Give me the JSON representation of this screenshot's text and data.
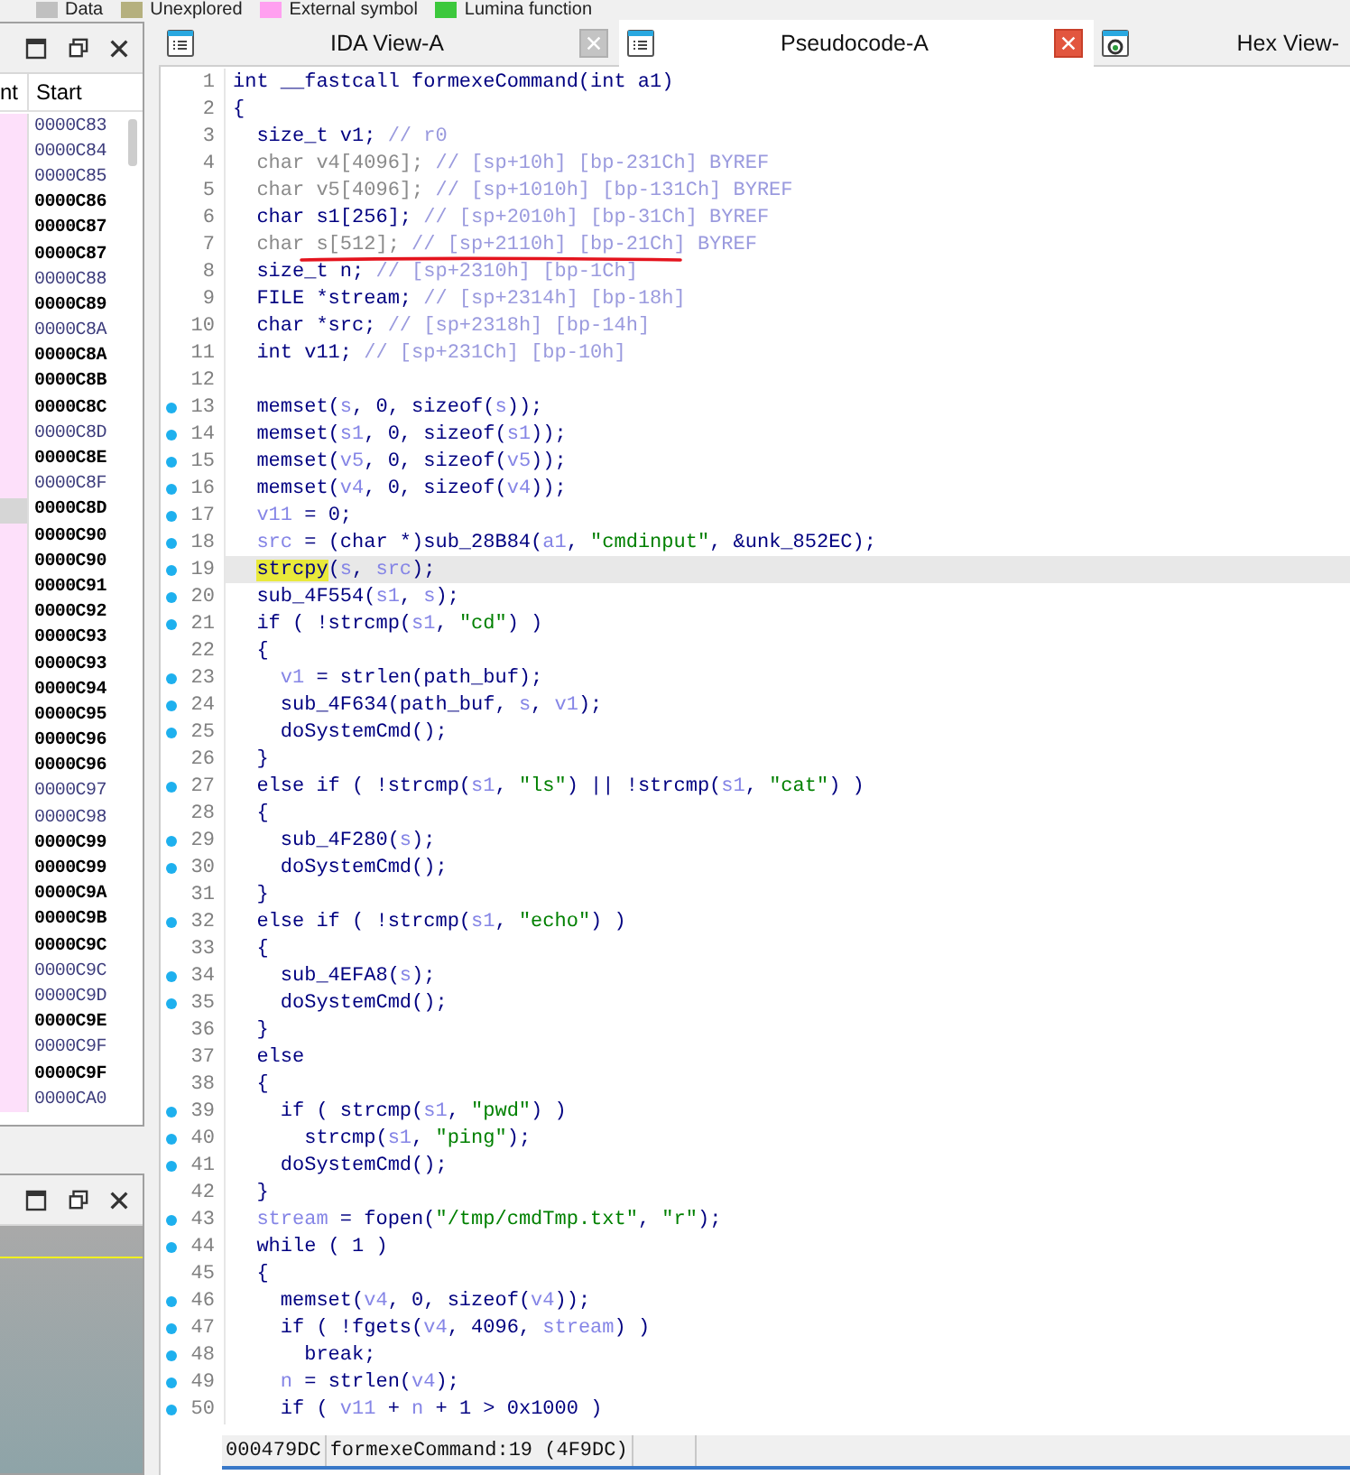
{
  "legend": [
    {
      "label": "Data",
      "color": "#c0c0c0"
    },
    {
      "label": "Unexplored",
      "color": "#b5b07e"
    },
    {
      "label": "External symbol",
      "color": "#ffa0f0"
    },
    {
      "label": "Lumina function",
      "color": "#3cc83c"
    }
  ],
  "segments_panel": {
    "columns": [
      "nt",
      "Start"
    ],
    "rows": [
      {
        "start": "0000C83",
        "bold": false,
        "selected": false
      },
      {
        "start": "0000C84",
        "bold": false,
        "selected": false
      },
      {
        "start": "0000C85",
        "bold": false,
        "selected": false
      },
      {
        "start": "0000C86",
        "bold": true,
        "selected": false
      },
      {
        "start": "0000C87",
        "bold": true,
        "selected": false
      },
      {
        "start": "0000C87",
        "bold": true,
        "selected": false
      },
      {
        "start": "0000C88",
        "bold": false,
        "selected": false
      },
      {
        "start": "0000C89",
        "bold": true,
        "selected": false
      },
      {
        "start": "0000C8A",
        "bold": false,
        "selected": false
      },
      {
        "start": "0000C8A",
        "bold": true,
        "selected": false
      },
      {
        "start": "0000C8B",
        "bold": true,
        "selected": false
      },
      {
        "start": "0000C8C",
        "bold": true,
        "selected": false
      },
      {
        "start": "0000C8D",
        "bold": false,
        "selected": false
      },
      {
        "start": "0000C8E",
        "bold": true,
        "selected": false
      },
      {
        "start": "0000C8F",
        "bold": false,
        "selected": false
      },
      {
        "start": "0000C8D",
        "bold": true,
        "selected": true
      },
      {
        "start": "0000C90",
        "bold": true,
        "selected": false
      },
      {
        "start": "0000C90",
        "bold": true,
        "selected": false
      },
      {
        "start": "0000C91",
        "bold": true,
        "selected": false
      },
      {
        "start": "0000C92",
        "bold": true,
        "selected": false
      },
      {
        "start": "0000C93",
        "bold": true,
        "selected": false
      },
      {
        "start": "0000C93",
        "bold": true,
        "selected": false
      },
      {
        "start": "0000C94",
        "bold": true,
        "selected": false
      },
      {
        "start": "0000C95",
        "bold": true,
        "selected": false
      },
      {
        "start": "0000C96",
        "bold": true,
        "selected": false
      },
      {
        "start": "0000C96",
        "bold": true,
        "selected": false
      },
      {
        "start": "0000C97",
        "bold": false,
        "selected": false
      },
      {
        "start": "0000C98",
        "bold": false,
        "selected": false
      },
      {
        "start": "0000C99",
        "bold": true,
        "selected": false
      },
      {
        "start": "0000C99",
        "bold": true,
        "selected": false
      },
      {
        "start": "0000C9A",
        "bold": true,
        "selected": false
      },
      {
        "start": "0000C9B",
        "bold": true,
        "selected": false
      },
      {
        "start": "0000C9C",
        "bold": true,
        "selected": false
      },
      {
        "start": "0000C9C",
        "bold": false,
        "selected": false
      },
      {
        "start": "0000C9D",
        "bold": false,
        "selected": false
      },
      {
        "start": "0000C9E",
        "bold": true,
        "selected": false
      },
      {
        "start": "0000C9F",
        "bold": false,
        "selected": false
      },
      {
        "start": "0000C9F",
        "bold": true,
        "selected": false
      },
      {
        "start": "0000CA0",
        "bold": false,
        "selected": false
      }
    ]
  },
  "tabs": [
    {
      "label": "IDA View-A",
      "kind": "listing",
      "selected": false,
      "closable": true
    },
    {
      "label": "Pseudocode-A",
      "kind": "listing",
      "selected": true,
      "closable": true
    },
    {
      "label": "Hex View-",
      "kind": "hex",
      "selected": false,
      "closable": false
    }
  ],
  "code": [
    {
      "number": "1",
      "dot": false,
      "current": false,
      "parts": [
        {
          "kind": "c",
          "text": "int __fastcall formexeCommand(int a1)"
        }
      ]
    },
    {
      "number": "2",
      "dot": false,
      "current": false,
      "parts": [
        {
          "kind": "c",
          "text": "{"
        }
      ]
    },
    {
      "number": "3",
      "dot": false,
      "current": false,
      "parts": [
        {
          "kind": "c",
          "text": "  size_t v1; "
        },
        {
          "kind": "m",
          "text": "// r0"
        }
      ]
    },
    {
      "number": "4",
      "dot": false,
      "current": false,
      "parts": [
        {
          "kind": "g",
          "text": "  char v4[4096]; "
        },
        {
          "kind": "m",
          "text": "// [sp+10h] [bp-231Ch] BYREF"
        }
      ]
    },
    {
      "number": "5",
      "dot": false,
      "current": false,
      "parts": [
        {
          "kind": "g",
          "text": "  char v5[4096]; "
        },
        {
          "kind": "m",
          "text": "// [sp+1010h] [bp-131Ch] BYREF"
        }
      ]
    },
    {
      "number": "6",
      "dot": false,
      "current": false,
      "parts": [
        {
          "kind": "c",
          "text": "  char s1[256]; "
        },
        {
          "kind": "m",
          "text": "// [sp+2010h] [bp-31Ch] BYREF"
        }
      ]
    },
    {
      "number": "7",
      "dot": false,
      "current": false,
      "parts": [
        {
          "kind": "g",
          "text": "  char s[512]; "
        },
        {
          "kind": "m",
          "text": "// [sp+2110h] [bp-21Ch] BYREF"
        }
      ]
    },
    {
      "number": "8",
      "dot": false,
      "current": false,
      "parts": [
        {
          "kind": "c",
          "text": "  size_t n; "
        },
        {
          "kind": "m",
          "text": "// [sp+2310h] [bp-1Ch]"
        }
      ]
    },
    {
      "number": "9",
      "dot": false,
      "current": false,
      "parts": [
        {
          "kind": "c",
          "text": "  FILE *stream; "
        },
        {
          "kind": "m",
          "text": "// [sp+2314h] [bp-18h]"
        }
      ]
    },
    {
      "number": "10",
      "dot": false,
      "current": false,
      "parts": [
        {
          "kind": "c",
          "text": "  char *src; "
        },
        {
          "kind": "m",
          "text": "// [sp+2318h] [bp-14h]"
        }
      ]
    },
    {
      "number": "11",
      "dot": false,
      "current": false,
      "parts": [
        {
          "kind": "c",
          "text": "  int v11; "
        },
        {
          "kind": "m",
          "text": "// [sp+231Ch] [bp-10h]"
        }
      ]
    },
    {
      "number": "12",
      "dot": false,
      "current": false
    },
    {
      "number": "13",
      "dot": true,
      "current": false,
      "parts": [
        {
          "kind": "c",
          "text": "  memset("
        },
        {
          "kind": "v",
          "text": "s"
        },
        {
          "kind": "c",
          "text": ", 0, sizeof("
        },
        {
          "kind": "v",
          "text": "s"
        },
        {
          "kind": "c",
          "text": "));"
        }
      ]
    },
    {
      "number": "14",
      "dot": true,
      "current": false,
      "parts": [
        {
          "kind": "c",
          "text": "  memset("
        },
        {
          "kind": "v",
          "text": "s1"
        },
        {
          "kind": "c",
          "text": ", 0, sizeof("
        },
        {
          "kind": "v",
          "text": "s1"
        },
        {
          "kind": "c",
          "text": "));"
        }
      ]
    },
    {
      "number": "15",
      "dot": true,
      "current": false,
      "parts": [
        {
          "kind": "c",
          "text": "  memset("
        },
        {
          "kind": "v",
          "text": "v5"
        },
        {
          "kind": "c",
          "text": ", 0, sizeof("
        },
        {
          "kind": "v",
          "text": "v5"
        },
        {
          "kind": "c",
          "text": "));"
        }
      ]
    },
    {
      "number": "16",
      "dot": true,
      "current": false,
      "parts": [
        {
          "kind": "c",
          "text": "  memset("
        },
        {
          "kind": "v",
          "text": "v4"
        },
        {
          "kind": "c",
          "text": ", 0, sizeof("
        },
        {
          "kind": "v",
          "text": "v4"
        },
        {
          "kind": "c",
          "text": "));"
        }
      ]
    },
    {
      "number": "17",
      "dot": true,
      "current": false,
      "parts": [
        {
          "kind": "v",
          "text": "  v11"
        },
        {
          "kind": "c",
          "text": " = 0;"
        }
      ]
    },
    {
      "number": "18",
      "dot": true,
      "current": false,
      "parts": [
        {
          "kind": "v",
          "text": "  src"
        },
        {
          "kind": "c",
          "text": " = (char *)sub_28B84("
        },
        {
          "kind": "v",
          "text": "a1"
        },
        {
          "kind": "c",
          "text": ", "
        },
        {
          "kind": "s",
          "text": "\"cmdinput\""
        },
        {
          "kind": "c",
          "text": ", &unk_852EC);"
        }
      ]
    },
    {
      "number": "19",
      "dot": true,
      "current": true,
      "parts": [
        {
          "kind": "h",
          "text": "  strcpy"
        },
        {
          "kind": "c",
          "text": "("
        },
        {
          "kind": "v",
          "text": "s"
        },
        {
          "kind": "c",
          "text": ", "
        },
        {
          "kind": "v",
          "text": "src"
        },
        {
          "kind": "c",
          "text": ");"
        }
      ]
    },
    {
      "number": "20",
      "dot": true,
      "current": false,
      "parts": [
        {
          "kind": "c",
          "text": "  sub_4F554("
        },
        {
          "kind": "v",
          "text": "s1"
        },
        {
          "kind": "c",
          "text": ", "
        },
        {
          "kind": "v",
          "text": "s"
        },
        {
          "kind": "c",
          "text": ");"
        }
      ]
    },
    {
      "number": "21",
      "dot": true,
      "current": false,
      "parts": [
        {
          "kind": "c",
          "text": "  if ( !strcmp("
        },
        {
          "kind": "v",
          "text": "s1"
        },
        {
          "kind": "c",
          "text": ", "
        },
        {
          "kind": "s",
          "text": "\"cd\""
        },
        {
          "kind": "c",
          "text": ") )"
        }
      ]
    },
    {
      "number": "22",
      "dot": false,
      "current": false,
      "parts": [
        {
          "kind": "c",
          "text": "  {"
        }
      ]
    },
    {
      "number": "23",
      "dot": true,
      "current": false,
      "parts": [
        {
          "kind": "v",
          "text": "    v1"
        },
        {
          "kind": "c",
          "text": " = strlen(path_buf);"
        }
      ]
    },
    {
      "number": "24",
      "dot": true,
      "current": false,
      "parts": [
        {
          "kind": "c",
          "text": "    sub_4F634(path_buf, "
        },
        {
          "kind": "v",
          "text": "s"
        },
        {
          "kind": "c",
          "text": ", "
        },
        {
          "kind": "v",
          "text": "v1"
        },
        {
          "kind": "c",
          "text": ");"
        }
      ]
    },
    {
      "number": "25",
      "dot": true,
      "current": false,
      "parts": [
        {
          "kind": "c",
          "text": "    doSystemCmd();"
        }
      ]
    },
    {
      "number": "26",
      "dot": false,
      "current": false,
      "parts": [
        {
          "kind": "c",
          "text": "  }"
        }
      ]
    },
    {
      "number": "27",
      "dot": true,
      "current": false,
      "parts": [
        {
          "kind": "c",
          "text": "  else if ( !strcmp("
        },
        {
          "kind": "v",
          "text": "s1"
        },
        {
          "kind": "c",
          "text": ", "
        },
        {
          "kind": "s",
          "text": "\"ls\""
        },
        {
          "kind": "c",
          "text": ") || !strcmp("
        },
        {
          "kind": "v",
          "text": "s1"
        },
        {
          "kind": "c",
          "text": ", "
        },
        {
          "kind": "s",
          "text": "\"cat\""
        },
        {
          "kind": "c",
          "text": ") )"
        }
      ]
    },
    {
      "number": "28",
      "dot": false,
      "current": false,
      "parts": [
        {
          "kind": "c",
          "text": "  {"
        }
      ]
    },
    {
      "number": "29",
      "dot": true,
      "current": false,
      "parts": [
        {
          "kind": "c",
          "text": "    sub_4F280("
        },
        {
          "kind": "v",
          "text": "s"
        },
        {
          "kind": "c",
          "text": ");"
        }
      ]
    },
    {
      "number": "30",
      "dot": true,
      "current": false,
      "parts": [
        {
          "kind": "c",
          "text": "    doSystemCmd();"
        }
      ]
    },
    {
      "number": "31",
      "dot": false,
      "current": false,
      "parts": [
        {
          "kind": "c",
          "text": "  }"
        }
      ]
    },
    {
      "number": "32",
      "dot": true,
      "current": false,
      "parts": [
        {
          "kind": "c",
          "text": "  else if ( !strcmp("
        },
        {
          "kind": "v",
          "text": "s1"
        },
        {
          "kind": "c",
          "text": ", "
        },
        {
          "kind": "s",
          "text": "\"echo\""
        },
        {
          "kind": "c",
          "text": ") )"
        }
      ]
    },
    {
      "number": "33",
      "dot": false,
      "current": false,
      "parts": [
        {
          "kind": "c",
          "text": "  {"
        }
      ]
    },
    {
      "number": "34",
      "dot": true,
      "current": false,
      "parts": [
        {
          "kind": "c",
          "text": "    sub_4EFA8("
        },
        {
          "kind": "v",
          "text": "s"
        },
        {
          "kind": "c",
          "text": ");"
        }
      ]
    },
    {
      "number": "35",
      "dot": true,
      "current": false,
      "parts": [
        {
          "kind": "c",
          "text": "    doSystemCmd();"
        }
      ]
    },
    {
      "number": "36",
      "dot": false,
      "current": false,
      "parts": [
        {
          "kind": "c",
          "text": "  }"
        }
      ]
    },
    {
      "number": "37",
      "dot": false,
      "current": false,
      "parts": [
        {
          "kind": "c",
          "text": "  else"
        }
      ]
    },
    {
      "number": "38",
      "dot": false,
      "current": false,
      "parts": [
        {
          "kind": "c",
          "text": "  {"
        }
      ]
    },
    {
      "number": "39",
      "dot": true,
      "current": false,
      "parts": [
        {
          "kind": "c",
          "text": "    if ( strcmp("
        },
        {
          "kind": "v",
          "text": "s1"
        },
        {
          "kind": "c",
          "text": ", "
        },
        {
          "kind": "s",
          "text": "\"pwd\""
        },
        {
          "kind": "c",
          "text": ") )"
        }
      ]
    },
    {
      "number": "40",
      "dot": true,
      "current": false,
      "parts": [
        {
          "kind": "c",
          "text": "      strcmp("
        },
        {
          "kind": "v",
          "text": "s1"
        },
        {
          "kind": "c",
          "text": ", "
        },
        {
          "kind": "s",
          "text": "\"ping\""
        },
        {
          "kind": "c",
          "text": ");"
        }
      ]
    },
    {
      "number": "41",
      "dot": true,
      "current": false,
      "parts": [
        {
          "kind": "c",
          "text": "    doSystemCmd();"
        }
      ]
    },
    {
      "number": "42",
      "dot": false,
      "current": false,
      "parts": [
        {
          "kind": "c",
          "text": "  }"
        }
      ]
    },
    {
      "number": "43",
      "dot": true,
      "current": false,
      "parts": [
        {
          "kind": "v",
          "text": "  stream"
        },
        {
          "kind": "c",
          "text": " = fopen("
        },
        {
          "kind": "s",
          "text": "\"/tmp/cmdTmp.txt\""
        },
        {
          "kind": "c",
          "text": ", "
        },
        {
          "kind": "s",
          "text": "\"r\""
        },
        {
          "kind": "c",
          "text": ");"
        }
      ]
    },
    {
      "number": "44",
      "dot": true,
      "current": false,
      "parts": [
        {
          "kind": "c",
          "text": "  while ( 1 )"
        }
      ]
    },
    {
      "number": "45",
      "dot": false,
      "current": false,
      "parts": [
        {
          "kind": "c",
          "text": "  {"
        }
      ]
    },
    {
      "number": "46",
      "dot": true,
      "current": false,
      "parts": [
        {
          "kind": "c",
          "text": "    memset("
        },
        {
          "kind": "v",
          "text": "v4"
        },
        {
          "kind": "c",
          "text": ", 0, sizeof("
        },
        {
          "kind": "v",
          "text": "v4"
        },
        {
          "kind": "c",
          "text": "));"
        }
      ]
    },
    {
      "number": "47",
      "dot": true,
      "current": false,
      "parts": [
        {
          "kind": "c",
          "text": "    if ( !fgets("
        },
        {
          "kind": "v",
          "text": "v4"
        },
        {
          "kind": "c",
          "text": ", 4096, "
        },
        {
          "kind": "v",
          "text": "stream"
        },
        {
          "kind": "c",
          "text": ") )"
        }
      ]
    },
    {
      "number": "48",
      "dot": true,
      "current": false,
      "parts": [
        {
          "kind": "c",
          "text": "      break;"
        }
      ]
    },
    {
      "number": "49",
      "dot": true,
      "current": false,
      "parts": [
        {
          "kind": "v",
          "text": "    n"
        },
        {
          "kind": "c",
          "text": " = strlen("
        },
        {
          "kind": "v",
          "text": "v4"
        },
        {
          "kind": "c",
          "text": ");"
        }
      ]
    },
    {
      "number": "50",
      "dot": true,
      "current": false,
      "parts": [
        {
          "kind": "c",
          "text": "    if ( "
        },
        {
          "kind": "v",
          "text": "v11"
        },
        {
          "kind": "c",
          "text": " + "
        },
        {
          "kind": "v",
          "text": "n"
        },
        {
          "kind": "c",
          "text": " + 1 > 0x1000 )"
        }
      ]
    }
  ],
  "status_bar": {
    "address": "000479DC",
    "location": "formexeCommand:19 (4F9DC)"
  }
}
